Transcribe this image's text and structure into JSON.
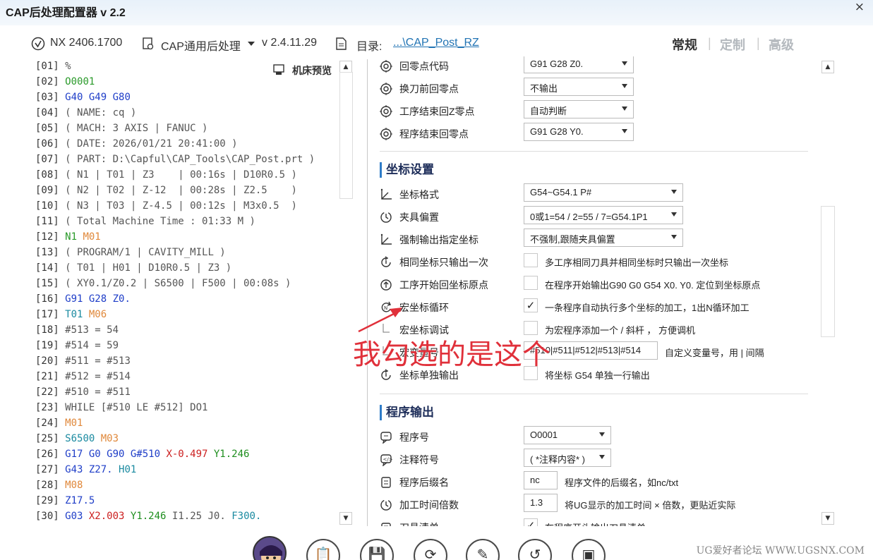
{
  "app_title": "CAP后处理配置器 v 2.2",
  "close_glyph": "×",
  "infobar": {
    "nx_version": "NX 2406.1700",
    "post_name": "CAP通用后处理",
    "post_version": "v 2.4.11.29",
    "dir_label": "目录:",
    "dir_link": "...\\CAP_Post_RZ"
  },
  "tabs": [
    {
      "label": "常规",
      "active": true
    },
    {
      "label": "定制",
      "active": false
    },
    {
      "label": "高级",
      "active": false
    }
  ],
  "tab_separator": "|",
  "preview_button": "机床预览",
  "code_lines": [
    {
      "n": "[01]",
      "parts": [
        [
          "%",
          "c-gray"
        ]
      ]
    },
    {
      "n": "[02]",
      "parts": [
        [
          "O0001",
          "c-green"
        ]
      ]
    },
    {
      "n": "[03]",
      "parts": [
        [
          "G40 G49 G80",
          "c-blue"
        ]
      ]
    },
    {
      "n": "[04]",
      "parts": [
        [
          "( NAME: cq )",
          "c-gray"
        ]
      ]
    },
    {
      "n": "[05]",
      "parts": [
        [
          "( MACH: 3 AXIS | FANUC )",
          "c-gray"
        ]
      ]
    },
    {
      "n": "[06]",
      "parts": [
        [
          "( DATE: 2026/01/21 20:41:00 )",
          "c-gray"
        ]
      ]
    },
    {
      "n": "[07]",
      "parts": [
        [
          "( PART: D:\\Capful\\CAP_Tools\\CAP_Post.prt )",
          "c-gray"
        ]
      ]
    },
    {
      "n": "[08]",
      "parts": [
        [
          "( N1 | T01 | Z3    | 00:16s | D10R0.5 )",
          "c-gray"
        ]
      ]
    },
    {
      "n": "[09]",
      "parts": [
        [
          "( N2 | T02 | Z-12  | 00:28s | Z2.5    )",
          "c-gray"
        ]
      ]
    },
    {
      "n": "[10]",
      "parts": [
        [
          "( N3 | T03 | Z-4.5 | 00:12s | M3x0.5  )",
          "c-gray"
        ]
      ]
    },
    {
      "n": "[11]",
      "parts": [
        [
          "( Total Machine Time : 01:33 M )",
          "c-gray"
        ]
      ]
    },
    {
      "n": "[12]",
      "parts": [
        [
          "N1",
          "c-green"
        ],
        [
          " M01",
          "c-orange"
        ]
      ]
    },
    {
      "n": "[13]",
      "parts": [
        [
          "( PROGRAM/1 | CAVITY_MILL )",
          "c-gray"
        ]
      ]
    },
    {
      "n": "[14]",
      "parts": [
        [
          "( T01 | H01 | D10R0.5 | Z3 )",
          "c-gray"
        ]
      ]
    },
    {
      "n": "[15]",
      "parts": [
        [
          "( XY0.1/Z0.2 | S6500 | F500 | 00:08s )",
          "c-gray"
        ]
      ]
    },
    {
      "n": "[16]",
      "parts": [
        [
          "G91 G28 Z0.",
          "c-blue"
        ]
      ]
    },
    {
      "n": "[17]",
      "parts": [
        [
          "T01",
          "c-teal"
        ],
        [
          " M06",
          "c-orange"
        ]
      ]
    },
    {
      "n": "[18]",
      "parts": [
        [
          "#513 = 54",
          "c-gray"
        ]
      ]
    },
    {
      "n": "[19]",
      "parts": [
        [
          "#514 = 59",
          "c-gray"
        ]
      ]
    },
    {
      "n": "[20]",
      "parts": [
        [
          "#511 = #513",
          "c-gray"
        ]
      ]
    },
    {
      "n": "[21]",
      "parts": [
        [
          "#512 = #514",
          "c-gray"
        ]
      ]
    },
    {
      "n": "[22]",
      "parts": [
        [
          "#510 = #511",
          "c-gray"
        ]
      ]
    },
    {
      "n": "[23]",
      "parts": [
        [
          "WHILE [#510 LE #512] DO1",
          "c-gray"
        ]
      ]
    },
    {
      "n": "[24]",
      "parts": [
        [
          "M01",
          "c-orange"
        ]
      ]
    },
    {
      "n": "[25]",
      "parts": [
        [
          "S6500",
          "c-teal"
        ],
        [
          " M03",
          "c-orange"
        ]
      ]
    },
    {
      "n": "[26]",
      "parts": [
        [
          "G17 G0 G90 G#510",
          "c-blue"
        ],
        [
          " X-0.497",
          "c-red"
        ],
        [
          " Y1.246",
          "c-dgreen"
        ]
      ]
    },
    {
      "n": "[27]",
      "parts": [
        [
          "G43 Z27.",
          "c-blue"
        ],
        [
          " H01",
          "c-teal"
        ]
      ]
    },
    {
      "n": "[28]",
      "parts": [
        [
          "M08",
          "c-orange"
        ]
      ]
    },
    {
      "n": "[29]",
      "parts": [
        [
          "Z17.5",
          "c-blue"
        ]
      ]
    },
    {
      "n": "[30]",
      "parts": [
        [
          "G03",
          "c-blue"
        ],
        [
          " X2.003",
          "c-red"
        ],
        [
          " Y1.246",
          "c-dgreen"
        ],
        [
          " I1.25 J0.",
          "c-gray"
        ],
        [
          " F300.",
          "c-teal"
        ]
      ]
    }
  ],
  "settings": {
    "rows_top": [
      {
        "label": "回零点代码",
        "value": "G91 G28 Z0.",
        "icon": "target-icon"
      },
      {
        "label": "换刀前回零点",
        "value": "不输出",
        "icon": "target-icon"
      },
      {
        "label": "工序结束回Z零点",
        "value": "自动判断",
        "icon": "target-icon"
      },
      {
        "label": "程序结束回零点",
        "value": "G91 G28 Y0.",
        "icon": "target-icon"
      }
    ],
    "coord_section": "坐标设置",
    "coord_rows": [
      {
        "label": "坐标格式",
        "type": "select",
        "value": "G54~G54.1 P#",
        "icon": "axis-icon"
      },
      {
        "label": "夹具偏置",
        "type": "select",
        "value": "0或1=54 / 2=55 / 7=G54.1P1",
        "icon": "clock-icon"
      },
      {
        "label": "强制输出指定坐标",
        "type": "select",
        "value": "不强制,跟随夹具偏置",
        "icon": "axis-icon"
      },
      {
        "label": "相同坐标只输出一次",
        "type": "check",
        "checked": false,
        "desc": "多工序相同刀具并相同坐标时只输出一次坐标",
        "icon": "cycle-icon"
      },
      {
        "label": "工序开始回坐标原点",
        "type": "check",
        "checked": false,
        "desc": "在程序开始输出G90 G0 G54 X0. Y0. 定位到坐标原点",
        "icon": "up-arrow-icon"
      },
      {
        "label": "宏坐标循环",
        "type": "check",
        "checked": true,
        "desc": "一条程序自动执行多个坐标的加工，1出N循环加工",
        "icon": "loop-icon"
      },
      {
        "label": "宏坐标调试",
        "type": "check",
        "checked": false,
        "desc": "为宏程序添加一个 / 斜杆 ， 方便调机",
        "icon": "tree-branch-icon"
      },
      {
        "label": "宏变量号",
        "type": "text",
        "value": "#510|#511|#512|#513|#514",
        "desc": "自定义变量号，用 | 间隔",
        "icon": "tree-branch-icon"
      },
      {
        "label": "坐标单独输出",
        "type": "check",
        "checked": false,
        "desc": "将坐标 G54 单独一行输出",
        "icon": "cycle-icon"
      }
    ],
    "program_section": "程序输出",
    "program_rows": [
      {
        "label": "程序号",
        "type": "select",
        "value": "O0001",
        "icon": "comment-icon"
      },
      {
        "label": "注释符号",
        "type": "select",
        "value": "( *注释内容* )",
        "icon": "code-comment-icon"
      },
      {
        "label": "程序后缀名",
        "type": "text",
        "value": "nc",
        "desc": "程序文件的后缀名，如nc/txt",
        "icon": "file-icon"
      },
      {
        "label": "加工时间倍数",
        "type": "text",
        "value": "1.3",
        "desc": "将UG显示的加工时间 × 倍数，更贴近实际",
        "icon": "clock-icon"
      },
      {
        "label": "刀具清单",
        "type": "check",
        "checked": true,
        "desc": "在程序开头输出刀具清单",
        "icon": "list-icon"
      }
    ]
  },
  "annotation": "我勾选的是这个",
  "bottom_buttons": [
    "clipboard-icon",
    "save-icon",
    "refresh-icon",
    "file-edit-icon",
    "undo-icon",
    "disk-icon"
  ],
  "watermark": "UG爱好者论坛 WWW.UGSNX.COM",
  "colors": {
    "accent": "#2e7cc8",
    "annotation": "#e0303a",
    "link": "#2274b4"
  }
}
